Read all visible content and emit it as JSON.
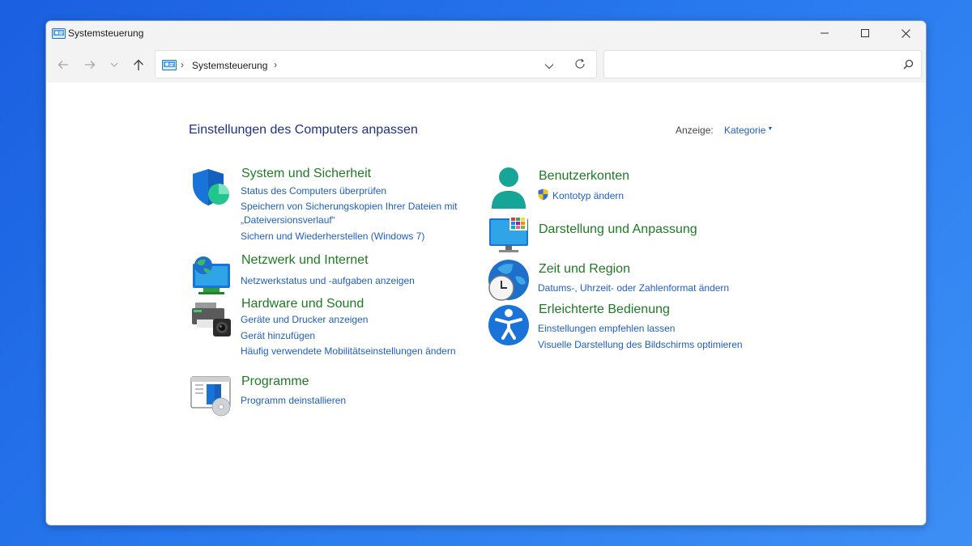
{
  "window": {
    "title": "Systemsteuerung"
  },
  "address": {
    "crumb": "Systemsteuerung",
    "sep": "›"
  },
  "search": {
    "placeholder": ""
  },
  "main": {
    "heading": "Einstellungen des Computers anpassen",
    "view_label": "Anzeige:",
    "view_value": "Kategorie"
  },
  "categories": {
    "system": {
      "title": "System und Sicherheit",
      "links": [
        "Status des Computers überprüfen",
        "Speichern von Sicherungskopien Ihrer Dateien mit",
        "„Dateiversionsverlauf“",
        "Sichern und Wiederherstellen (Windows 7)"
      ]
    },
    "network": {
      "title": "Netzwerk und Internet",
      "links": [
        "Netzwerkstatus und -aufgaben anzeigen"
      ]
    },
    "hardware": {
      "title": "Hardware und Sound",
      "links": [
        "Geräte und Drucker anzeigen",
        "Gerät hinzufügen",
        "Häufig verwendete Mobilitätseinstellungen ändern"
      ]
    },
    "programs": {
      "title": "Programme",
      "links": [
        "Programm deinstallieren"
      ]
    },
    "accounts": {
      "title": "Benutzerkonten",
      "links": [
        "Kontotyp ändern"
      ]
    },
    "appearance": {
      "title": "Darstellung und Anpassung",
      "links": []
    },
    "clock": {
      "title": "Zeit und Region",
      "links": [
        "Datums-, Uhrzeit- oder Zahlenformat ändern"
      ]
    },
    "ease": {
      "title": "Erleichterte Bedienung",
      "links": [
        "Einstellungen empfehlen lassen",
        "Visuelle Darstellung des Bildschirms optimieren"
      ]
    }
  },
  "icons": {
    "back": "arrow-left-icon",
    "forward": "arrow-right-icon",
    "recent": "chevron-down-icon",
    "up": "arrow-up-icon",
    "refresh": "refresh-icon",
    "search": "search-icon",
    "uac": "uac-shield-icon"
  },
  "colors": {
    "category_title": "#1f7a25",
    "link": "#1f5fbf",
    "heading": "#1e3287",
    "desktop": "#2a7cf0"
  }
}
